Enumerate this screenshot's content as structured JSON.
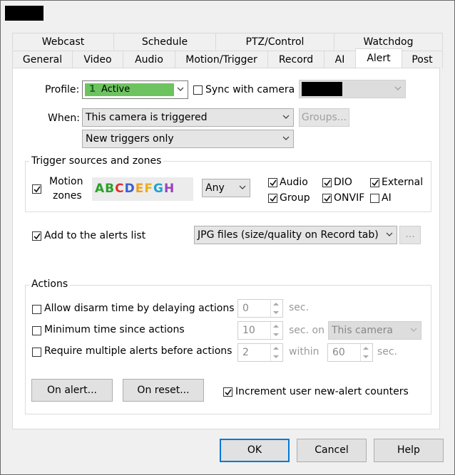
{
  "tabs_row1": [
    "Webcast",
    "Schedule",
    "PTZ/Control",
    "Watchdog"
  ],
  "tabs_row2": [
    "General",
    "Video",
    "Audio",
    "Motion/Trigger",
    "Record",
    "AI",
    "Alert",
    "Post"
  ],
  "active_tab": "Alert",
  "profile": {
    "label": "Profile:",
    "number": "1",
    "value": "Active",
    "color": "#6dc35f"
  },
  "sync": {
    "label": "Sync with camera",
    "checked": false
  },
  "when": {
    "label": "When:",
    "trigger": "This camera is triggered",
    "groups_button": "Groups...",
    "mode": "New triggers only"
  },
  "trigger_sources": {
    "title": "Trigger sources and zones",
    "motion_zones": {
      "label_line1": "Motion",
      "label_line2": "zones",
      "checked": true,
      "zones": [
        "A",
        "B",
        "C",
        "D",
        "E",
        "F",
        "G",
        "H"
      ],
      "zone_colors": [
        "#2aa02a",
        "#2aa02a",
        "#e0302a",
        "#3a5fcf",
        "#f0a020",
        "#e8b020",
        "#20a0d0",
        "#9a40c0"
      ],
      "match": "Any"
    },
    "sources": [
      {
        "label": "Audio",
        "checked": true
      },
      {
        "label": "DIO",
        "checked": true
      },
      {
        "label": "External",
        "checked": true
      },
      {
        "label": "Group",
        "checked": true
      },
      {
        "label": "ONVIF",
        "checked": true
      },
      {
        "label": "AI",
        "checked": false
      }
    ]
  },
  "alerts_list": {
    "label": "Add to the alerts list",
    "checked": true,
    "format": "JPG files (size/quality on Record tab)",
    "more_button": "..."
  },
  "actions": {
    "title": "Actions",
    "disarm": {
      "label": "Allow disarm time by delaying actions",
      "value": "0",
      "unit": "sec."
    },
    "min_time": {
      "label": "Minimum time since actions",
      "value": "10",
      "unit": "sec. on",
      "scope": "This camera"
    },
    "multiple": {
      "label": "Require multiple alerts before actions",
      "value": "2",
      "within": "within",
      "window": "60",
      "unit": "sec."
    },
    "on_alert": "On alert...",
    "on_reset": "On reset...",
    "increment": {
      "label": "Increment user new-alert counters",
      "checked": true
    }
  },
  "buttons": {
    "ok": "OK",
    "cancel": "Cancel",
    "help": "Help"
  }
}
